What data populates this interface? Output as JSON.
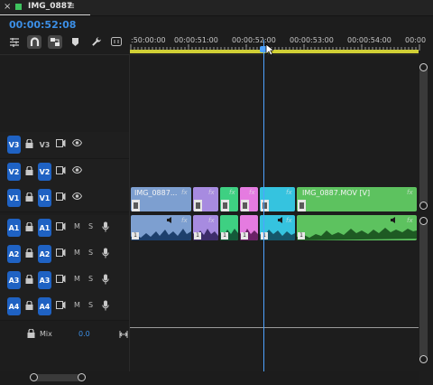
{
  "sequence": {
    "name": "IMG_0887",
    "color": "#3ec35e",
    "close_glyph": "×",
    "menu_glyph": "≡"
  },
  "timecode": "00:00:52:08",
  "toolbar": [
    "insert-overwrite-icon",
    "snap-magnet-icon",
    "linked-selection-icon",
    "add-marker-icon",
    "timeline-settings-wrench-icon",
    "captions-icon"
  ],
  "ruler": {
    "labels": [
      ":50:00:00",
      "00:00:51:00",
      "00:00:52:00",
      "00:00:53:00",
      "00:00:54:00",
      "00:00"
    ]
  },
  "tracks": {
    "video": [
      {
        "src": "V3",
        "label": "V3",
        "targeted": false
      },
      {
        "src": "V2",
        "label": "V2",
        "targeted": true
      },
      {
        "src": "V1",
        "label": "V1",
        "targeted": true
      }
    ],
    "audio": [
      {
        "src": "A1",
        "label": "A1",
        "m": "M",
        "s": "S"
      },
      {
        "src": "A2",
        "label": "A2",
        "m": "M",
        "s": "S"
      },
      {
        "src": "A3",
        "label": "A3",
        "m": "M",
        "s": "S"
      },
      {
        "src": "A4",
        "label": "A4",
        "m": "M",
        "s": "S"
      }
    ]
  },
  "mix": {
    "label": "Mix",
    "value": "0.0"
  },
  "clips": {
    "fx": "fx",
    "audio_badge": "1",
    "video": [
      {
        "name": "IMG_0887...",
        "color": "#7d9fd0"
      },
      {
        "name": "",
        "color": "#a78be0"
      },
      {
        "name": "",
        "color": "#3ed082"
      },
      {
        "name": "",
        "color": "#e57be0"
      },
      {
        "name": "",
        "color": "#35c3df"
      },
      {
        "name": "IMG_0887.MOV [V]",
        "color": "#5dc25f"
      }
    ]
  },
  "colors": {
    "accent": "#1f62c3",
    "playhead": "#4ea3ff",
    "work_area": "#d0cf35",
    "timecode": "#3c8fe6"
  }
}
